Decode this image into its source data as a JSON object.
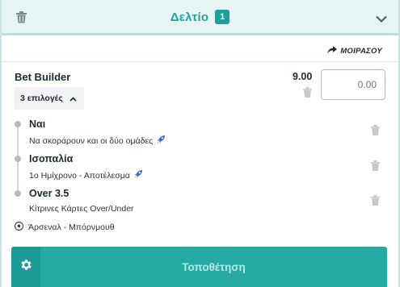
{
  "header": {
    "title": "Δελτίο",
    "count": "1",
    "accent": "#22a5a0"
  },
  "share": {
    "label": "ΜΟΙΡΑΣΟΥ"
  },
  "bet_builder": {
    "title": "Bet Builder",
    "odds": "9.00",
    "stake_placeholder": "0.00",
    "selections_toggle": "3 επιλογές"
  },
  "legs": [
    {
      "title": "Ναι",
      "subtitle": "Να σκοράρουν και οι δύο ομάδες"
    },
    {
      "title": "Ισοπαλία",
      "subtitle": "1ο Ημίχρονο - Αποτέλεσμα"
    },
    {
      "title": "Over 3.5",
      "subtitle": "Κίτρινες Κάρτες Over/Under"
    }
  ],
  "match": {
    "name": "Άρσεναλ - Μπόρνμουθ"
  },
  "footer": {
    "place_label": "Τοποθέτηση"
  }
}
